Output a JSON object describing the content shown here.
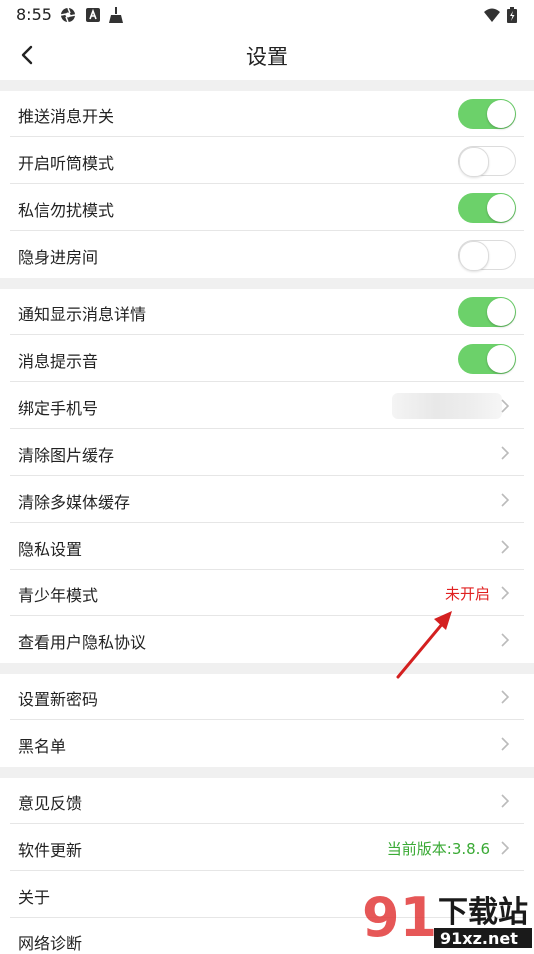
{
  "status_bar": {
    "time": "8:55"
  },
  "header": {
    "title": "设置"
  },
  "colors": {
    "toggle_on": "#6cd16a",
    "value_red": "#e02020",
    "value_green": "#3aaa35"
  },
  "rows": [
    {
      "label": "推送消息开关",
      "control": "toggle",
      "on": true
    },
    {
      "label": "开启听筒模式",
      "control": "toggle",
      "on": false
    },
    {
      "label": "私信勿扰模式",
      "control": "toggle",
      "on": true
    },
    {
      "label": "隐身进房间",
      "control": "toggle",
      "on": false
    },
    {
      "label": "通知显示消息详情",
      "control": "toggle",
      "on": true
    },
    {
      "label": "消息提示音",
      "control": "toggle",
      "on": true
    },
    {
      "label": "绑定手机号",
      "control": "chevron"
    },
    {
      "label": "清除图片缓存",
      "control": "chevron"
    },
    {
      "label": "清除多媒体缓存",
      "control": "chevron"
    },
    {
      "label": "隐私设置",
      "control": "chevron"
    },
    {
      "label": "青少年模式",
      "control": "chevron",
      "value": "未开启"
    },
    {
      "label": "查看用户隐私协议",
      "control": "chevron"
    },
    {
      "label": "设置新密码",
      "control": "chevron"
    },
    {
      "label": "黑名单",
      "control": "chevron"
    },
    {
      "label": "意见反馈",
      "control": "chevron"
    },
    {
      "label": "软件更新",
      "control": "chevron",
      "value": "当前版本:3.8.6"
    },
    {
      "label": "关于",
      "control": "chevron"
    },
    {
      "label": "网络诊断",
      "control": "chevron"
    }
  ],
  "watermark": {
    "brand": "下载站",
    "domain": "91xz.net"
  }
}
